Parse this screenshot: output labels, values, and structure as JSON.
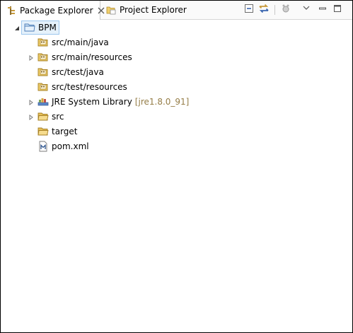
{
  "tabs": [
    {
      "label": "Package Explorer",
      "active": true
    },
    {
      "label": "Project Explorer",
      "active": false
    }
  ],
  "toolbar": [
    {
      "icon": "collapse-all-icon"
    },
    {
      "icon": "link-with-editor-icon"
    },
    {
      "icon": "focus-icon"
    },
    {
      "icon": "view-menu-icon"
    },
    {
      "icon": "minimize-icon"
    },
    {
      "icon": "maximize-icon"
    }
  ],
  "tree": {
    "root": {
      "label": "BPM",
      "expanded": true,
      "selected": true,
      "icon": "project-folder-icon"
    },
    "children": [
      {
        "label": "src/main/java",
        "icon": "source-folder-icon",
        "expandable": false
      },
      {
        "label": "src/main/resources",
        "icon": "source-folder-icon",
        "expandable": true
      },
      {
        "label": "src/test/java",
        "icon": "source-folder-icon",
        "expandable": false
      },
      {
        "label": "src/test/resources",
        "icon": "source-folder-icon",
        "expandable": false
      },
      {
        "label": "JRE System Library",
        "decoration": "[jre1.8.0_91]",
        "icon": "library-icon",
        "expandable": true
      },
      {
        "label": "src",
        "icon": "folder-icon",
        "expandable": true
      },
      {
        "label": "target",
        "icon": "folder-icon",
        "expandable": false
      },
      {
        "label": "pom.xml",
        "icon": "maven-file-icon",
        "expandable": false
      }
    ]
  },
  "colors": {
    "decoration": "#957d47",
    "selection_bg": "#e5f1fb",
    "selection_border": "#9dc7ee",
    "folder": "#e8c15a"
  }
}
